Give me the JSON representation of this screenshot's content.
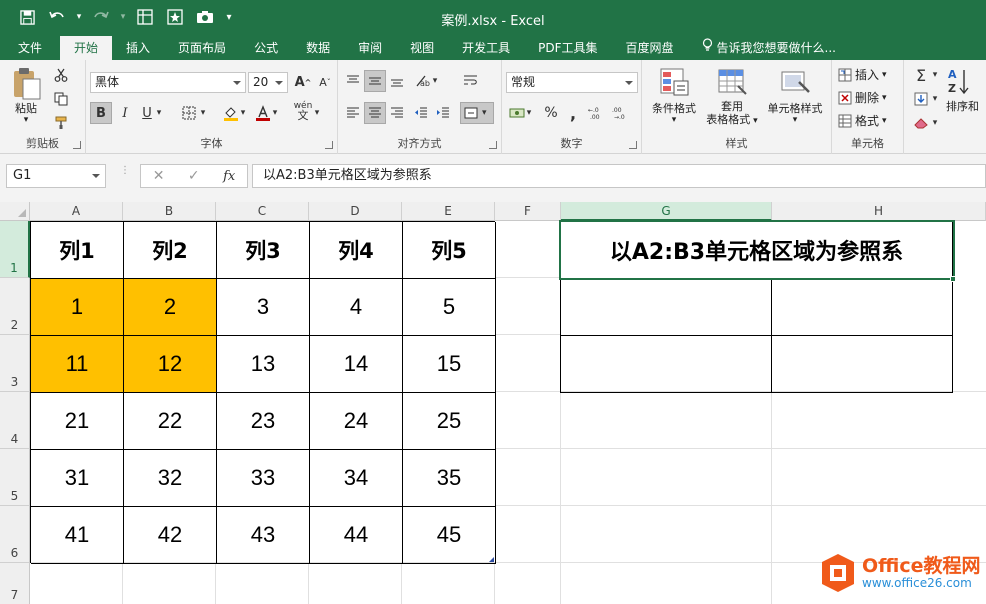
{
  "window": {
    "title": "案例.xlsx - Excel"
  },
  "tabs": [
    {
      "label": "文件"
    },
    {
      "label": "开始"
    },
    {
      "label": "插入"
    },
    {
      "label": "页面布局"
    },
    {
      "label": "公式"
    },
    {
      "label": "数据"
    },
    {
      "label": "审阅"
    },
    {
      "label": "视图"
    },
    {
      "label": "开发工具"
    },
    {
      "label": "PDF工具集"
    },
    {
      "label": "百度网盘"
    }
  ],
  "active_tab": "开始",
  "tell_me": "告诉我您想要做什么...",
  "ribbon": {
    "clipboard": {
      "label": "剪贴板",
      "paste": "粘贴"
    },
    "font": {
      "label": "字体",
      "family": "黑体",
      "size": "20",
      "bold": "B",
      "italic": "I",
      "underline": "U",
      "grow": "A",
      "shrink": "A",
      "phonetic": "wén"
    },
    "alignment": {
      "label": "对齐方式"
    },
    "number": {
      "label": "数字",
      "format": "常规",
      "percent": "%",
      "comma": ","
    },
    "styles": {
      "label": "样式",
      "conditional": "条件格式",
      "table1": "套用",
      "table2": "表格格式",
      "cell_styles": "单元格样式"
    },
    "cells": {
      "label": "单元格",
      "insert": "插入",
      "delete": "删除",
      "format": "格式"
    },
    "editing": {
      "sort": "排序和"
    }
  },
  "formula_bar": {
    "name_box": "G1",
    "cancel": "✕",
    "enter": "✓",
    "fx": "fx",
    "content": "以A2:B3单元格区域为参照系"
  },
  "columns": [
    "A",
    "B",
    "C",
    "D",
    "E",
    "F",
    "G",
    "H"
  ],
  "rows": [
    "1",
    "2",
    "3",
    "4",
    "5",
    "6",
    "7"
  ],
  "table": {
    "header": [
      "列1",
      "列2",
      "列3",
      "列4",
      "列5"
    ],
    "rows": [
      [
        "1",
        "2",
        "3",
        "4",
        "5"
      ],
      [
        "11",
        "12",
        "13",
        "14",
        "15"
      ],
      [
        "21",
        "22",
        "23",
        "24",
        "25"
      ],
      [
        "31",
        "32",
        "33",
        "34",
        "35"
      ],
      [
        "41",
        "42",
        "43",
        "44",
        "45"
      ]
    ],
    "highlight_color": "#FFC000"
  },
  "g_title": "以A2:B3单元格区域为参照系",
  "watermark": {
    "line1": "Office教程网",
    "line2": "www.office26.com"
  },
  "colors": {
    "excel_green": "#217346",
    "highlight": "#FFC000"
  }
}
